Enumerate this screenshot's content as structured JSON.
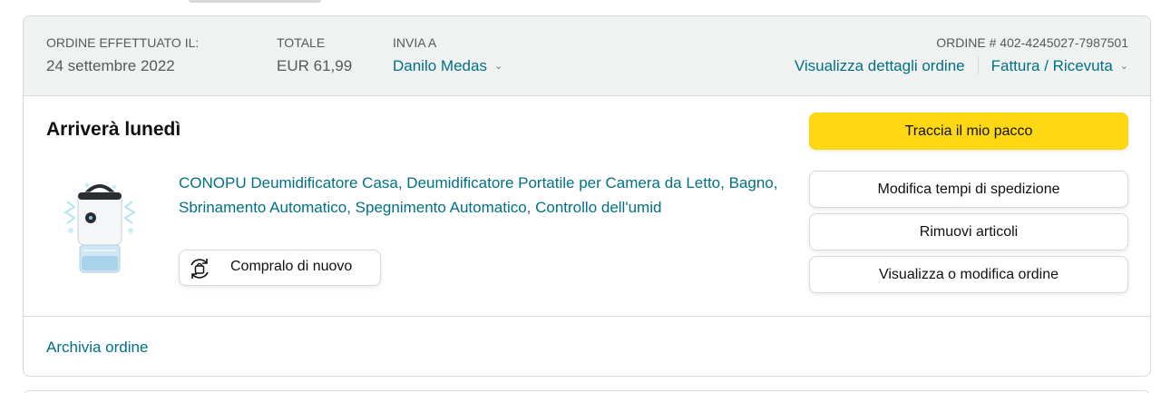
{
  "header": {
    "order_placed_label": "ORDINE EFFETTUATO IL:",
    "order_placed_value": "24 settembre 2022",
    "total_label": "TOTALE",
    "total_value": "EUR 61,99",
    "ship_to_label": "INVIA A",
    "ship_to_value": "Danilo Medas",
    "order_number_label": "ORDINE # 402-4245027-7987501",
    "view_details_link": "Visualizza dettagli ordine",
    "invoice_link": "Fattura / Ricevuta"
  },
  "shipment": {
    "status_title": "Arriverà lunedì",
    "product_name": "CONOPU Deumidificatore Casa, Deumidificatore Portatile per Camera da Letto, Bagno, Sbrinamento Automatico, Spegnimento Automatico, Controllo dell'umid",
    "buy_again_label": "Compralo di nuovo"
  },
  "actions": {
    "track_package": "Traccia il mio pacco",
    "change_delivery": "Modifica tempi di spedizione",
    "remove_items": "Rimuovi articoli",
    "view_edit_order": "Visualizza o modifica ordine"
  },
  "footer": {
    "archive_link": "Archivia ordine"
  },
  "colors": {
    "link": "#007185",
    "primary_button": "#FFD814",
    "header_bg": "#F0F2F2",
    "border": "#D5D9D9"
  }
}
